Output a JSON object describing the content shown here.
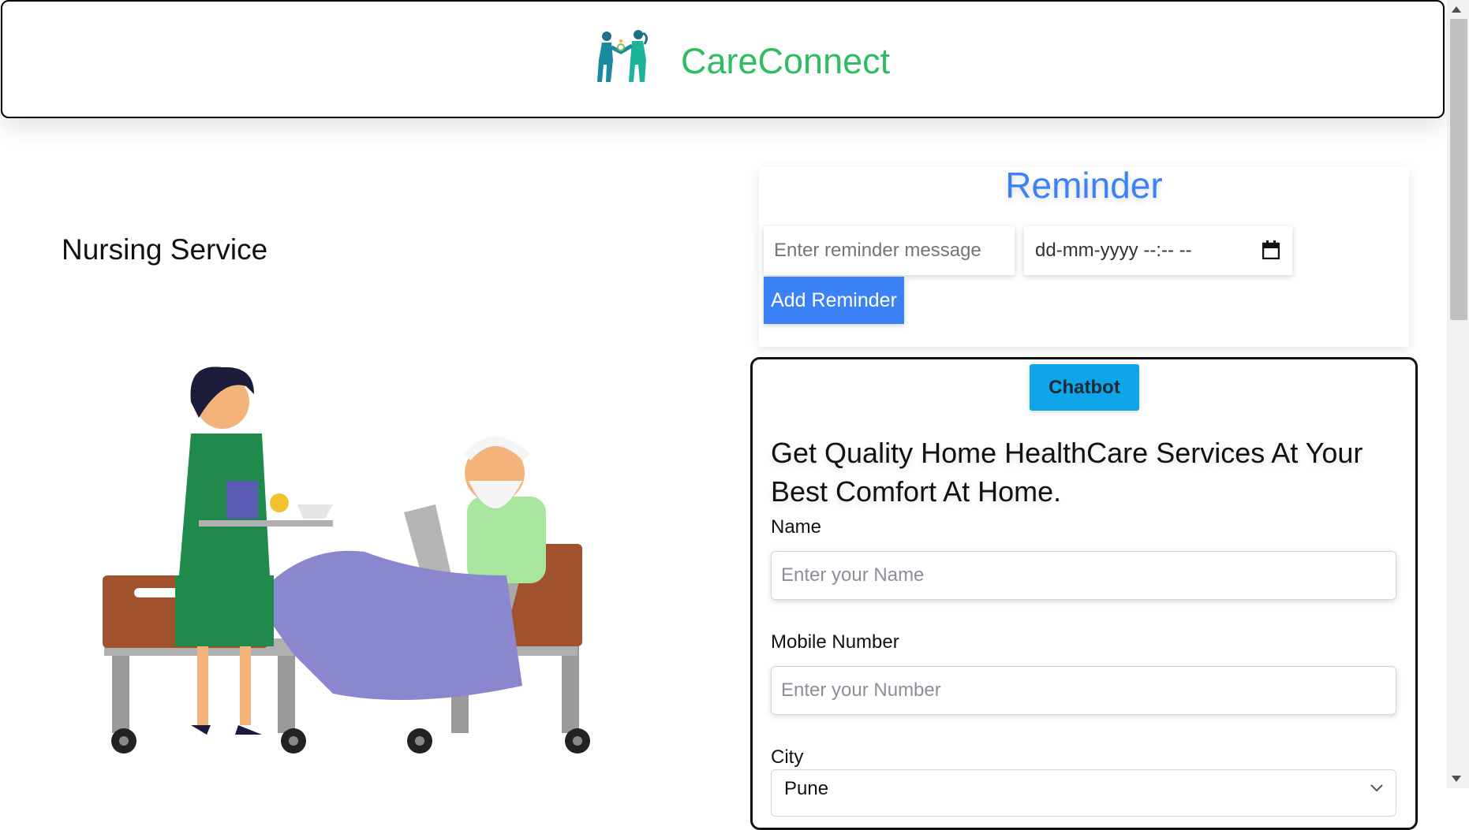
{
  "header": {
    "brand": "CareConnect",
    "logo_icon": "caregiver-people-icon"
  },
  "service": {
    "title": "Nursing Service",
    "image_icon": "nurse-patient-illustration"
  },
  "reminder": {
    "title": "Reminder",
    "message_placeholder": "Enter reminder message",
    "datetime_placeholder": "dd-mm-yyyy --:-- --",
    "add_button": "Add Reminder"
  },
  "chatbot": {
    "button": "Chatbot"
  },
  "form": {
    "heading": "Get Quality Home HealthCare Services At Your Best Comfort At Home.",
    "name_label": "Name",
    "name_placeholder": "Enter your Name",
    "mobile_label": "Mobile Number",
    "mobile_placeholder": "Enter your Number",
    "city_label": "City",
    "city_value": "Pune"
  },
  "colors": {
    "brand_green": "#2ebd61",
    "accent_blue": "#3b82f6",
    "chatbot_blue": "#0ea5e9"
  }
}
